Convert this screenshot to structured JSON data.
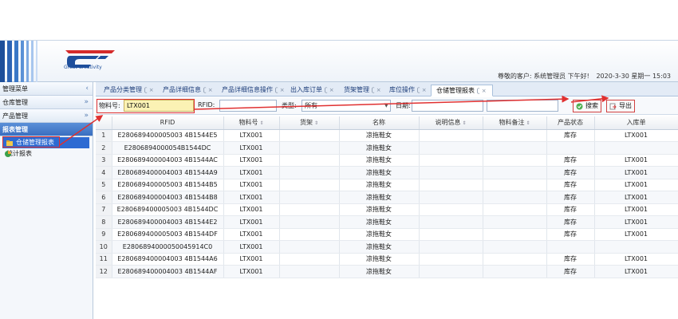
{
  "header": {
    "logo_text": "Great Creativity",
    "greeting": "尊敬的客户: 系统管理员 下午好!",
    "date": "2020-3-30 星期一 15:03"
  },
  "sidebar": {
    "items": [
      {
        "label": "管理菜单"
      },
      {
        "label": "仓库管理"
      },
      {
        "label": "产品管理"
      },
      {
        "label": "报表管理"
      }
    ],
    "subitems": [
      {
        "label": "仓储管理报表"
      },
      {
        "label": "统计报表"
      }
    ]
  },
  "tabs": [
    {
      "label": "产品分类管理"
    },
    {
      "label": "产品详细信息"
    },
    {
      "label": "产品详细信息操作"
    },
    {
      "label": "出入库订单"
    },
    {
      "label": "货架管理"
    },
    {
      "label": "库位操作"
    },
    {
      "label": "仓储管理报表"
    }
  ],
  "toolbar": {
    "material_label": "物料号:",
    "material_value": "LTX001",
    "rfid_label": "RFID:",
    "type_label": "类型:",
    "type_value": "所有",
    "date_label": "日期:",
    "search_label": "搜索",
    "export_label": "导出"
  },
  "table": {
    "columns": [
      "",
      "RFID",
      "物料号",
      "货架",
      "名称",
      "说明信息",
      "物料备注",
      "产品状态",
      "入库单"
    ],
    "rows": [
      [
        "1",
        "E280689400005003 4B1544E5",
        "LTX001",
        "",
        "凉拖鞋女",
        "",
        "",
        "库存",
        "LTX001"
      ],
      [
        "2",
        "E2806894000054B1544DC",
        "LTX001",
        "",
        "凉拖鞋女",
        "",
        "",
        "",
        ""
      ],
      [
        "3",
        "E280689400004003 4B1544AC",
        "LTX001",
        "",
        "凉拖鞋女",
        "",
        "",
        "库存",
        "LTX001"
      ],
      [
        "4",
        "E280689400004003 4B1544A9",
        "LTX001",
        "",
        "凉拖鞋女",
        "",
        "",
        "库存",
        "LTX001"
      ],
      [
        "5",
        "E280689400005003 4B1544B5",
        "LTX001",
        "",
        "凉拖鞋女",
        "",
        "",
        "库存",
        "LTX001"
      ],
      [
        "6",
        "E280689400004003 4B1544B8",
        "LTX001",
        "",
        "凉拖鞋女",
        "",
        "",
        "库存",
        "LTX001"
      ],
      [
        "7",
        "E280689400005003 4B1544DC",
        "LTX001",
        "",
        "凉拖鞋女",
        "",
        "",
        "库存",
        "LTX001"
      ],
      [
        "8",
        "E280689400004003 4B1544E2",
        "LTX001",
        "",
        "凉拖鞋女",
        "",
        "",
        "库存",
        "LTX001"
      ],
      [
        "9",
        "E280689400005003 4B1544DF",
        "LTX001",
        "",
        "凉拖鞋女",
        "",
        "",
        "库存",
        "LTX001"
      ],
      [
        "10",
        "E2806894000050045914C0",
        "LTX001",
        "",
        "凉拖鞋女",
        "",
        "",
        "",
        ""
      ],
      [
        "11",
        "E280689400004003 4B1544A6",
        "LTX001",
        "",
        "凉拖鞋女",
        "",
        "",
        "库存",
        "LTX001"
      ],
      [
        "12",
        "E280689400004003 4B1544AF",
        "LTX001",
        "",
        "凉拖鞋女",
        "",
        "",
        "库存",
        "LTX001"
      ]
    ]
  },
  "colors": {
    "accent": "#2e6bd2",
    "annotation": "#e03030",
    "highlight_input": "#fbf2b4"
  }
}
